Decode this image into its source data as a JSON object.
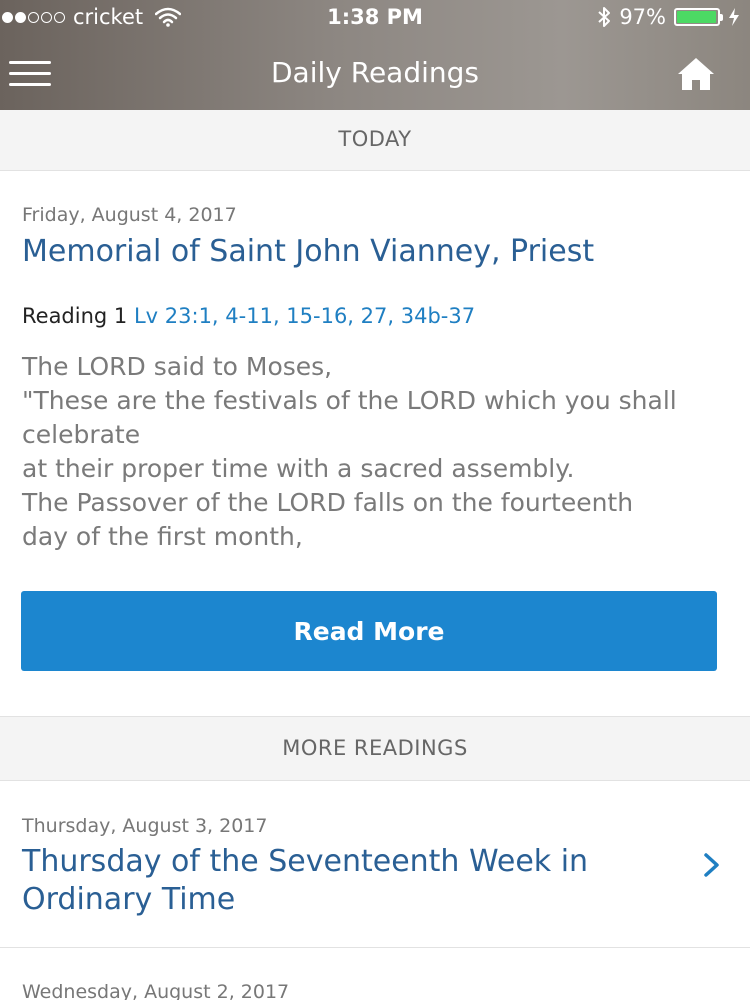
{
  "status_bar": {
    "carrier": "cricket",
    "time": "1:38 PM",
    "battery": "97%",
    "battery_level": 0.97
  },
  "nav": {
    "title": "Daily Readings",
    "menu_icon": "hamburger-icon",
    "home_icon": "home-icon"
  },
  "today": {
    "header": "TODAY",
    "date": "Friday, August 4, 2017",
    "title": "Memorial of Saint John Vianney, Priest",
    "reading_label": "Reading 1",
    "reading_ref": "Lv 23:1, 4-11, 15-16, 27, 34b-37",
    "excerpt_lines": [
      "The LORD said to Moses,",
      "\"These are the festivals of the LORD which you shall",
      "celebrate",
      "at their proper time with a sacred assembly.",
      "The Passover of the LORD falls on the fourteenth",
      "day of the first month,"
    ],
    "button_label": "Read More"
  },
  "more_readings": {
    "header": "MORE READINGS",
    "items": [
      {
        "date": "Thursday, August 3, 2017",
        "title_lines": [
          "Thursday of the Seventeenth Week in",
          "Ordinary Time"
        ]
      },
      {
        "date": "Wednesday, August 2, 2017"
      }
    ]
  },
  "colors": {
    "accent_blue": "#1c86cf",
    "title_blue": "#2a5f94",
    "battery_green": "#4cd964"
  }
}
